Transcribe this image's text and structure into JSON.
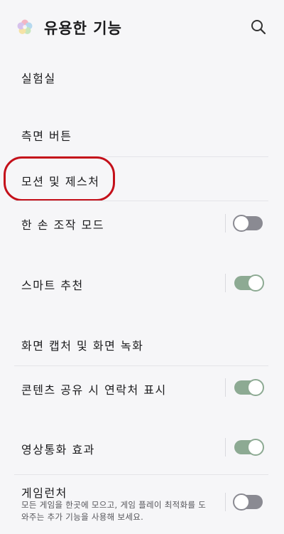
{
  "header": {
    "title": "유용한 기능",
    "logo_icon": "flower-icon",
    "search_icon": "search-icon"
  },
  "colors": {
    "toggle_on": "#8daa93",
    "toggle_off": "#8a8a92",
    "highlight": "#c4101a",
    "background": "#f6f6f8"
  },
  "items": [
    {
      "label": "실험실"
    },
    {
      "label": "측면 버튼"
    },
    {
      "label": "모션 및 제스처",
      "highlighted": true
    },
    {
      "label": "한 손 조작 모드",
      "toggle": "off"
    },
    {
      "label": "스마트 추천",
      "toggle": "on"
    },
    {
      "label": "화면 캡처 및 화면 녹화"
    },
    {
      "label": "콘텐츠 공유 시 연락처 표시",
      "toggle": "on"
    },
    {
      "label": "영상통화 효과",
      "toggle": "on"
    },
    {
      "label": "게임런처",
      "description": "모든 게임을 한곳에 모으고, 게임 플레이 최적화를 도와주는 추가 기능을 사용해 보세요.",
      "toggle": "off"
    }
  ]
}
